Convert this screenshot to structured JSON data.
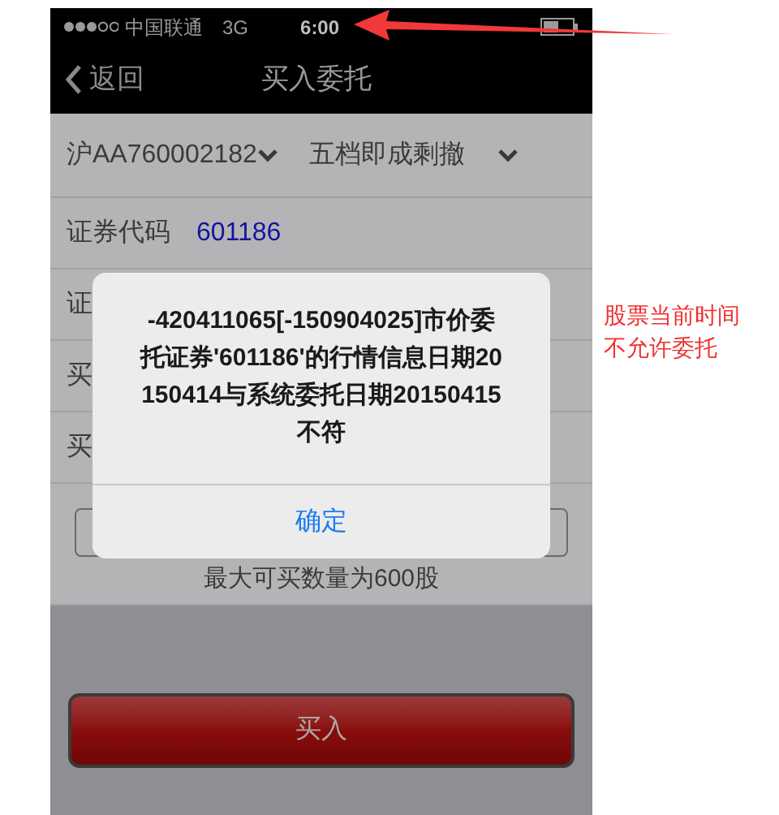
{
  "status_bar": {
    "carrier": "中国联通",
    "network": "3G",
    "time": "6:00"
  },
  "nav": {
    "back": "返回",
    "title": "买入委托"
  },
  "form": {
    "account": "沪AA760002182",
    "price_type": "五档即成剩撤",
    "rows": [
      {
        "label": "证券代码",
        "value": "601186"
      },
      {
        "label": "证"
      },
      {
        "label": "买"
      },
      {
        "label": "买"
      }
    ],
    "max_hint": "最大可买数量为600股"
  },
  "buy_button": "买入",
  "dialog": {
    "message": "-420411065[-150904025]市价委托证券'601186'的行情信息日期20150414与系统委托日期20150415不符",
    "button": "确定"
  },
  "annotation": {
    "lines": [
      "股票当前时间",
      "不允许委托"
    ]
  }
}
